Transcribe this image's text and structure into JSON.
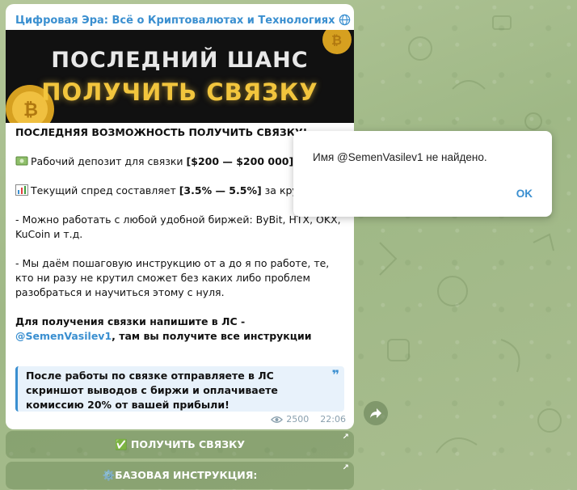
{
  "channel": {
    "title": "Цифровая Эра: Всё о Криптовалютах и Технологиях"
  },
  "banner": {
    "line1": "ПОСЛЕДНИЙ ШАНС",
    "line2": "ПОЛУЧИТЬ СВЯЗКУ"
  },
  "post": {
    "heading": "ПОСЛЕДНЯЯ ВОЗМОЖНОСТЬ ПОЛУЧИТЬ СВЯЗКУ!",
    "deposit_label": "Рабочий депозит для связки ",
    "deposit_value": "[$200 — $200 000]",
    "spread_label": "Текущий спред составляет ",
    "spread_value": "[3.5% — 5.5%]",
    "spread_suffix": " за круг",
    "exchanges": "- Можно работать с любой удобной биржей: ByBit, HTX, OKX, KuCoin и т.д.",
    "instruction": "- Мы даём пошаговую инструкцию от а до я по работе, те, кто ни разу не крутил сможет без каких либо проблем разобраться и научиться этому с нуля.",
    "contact_prefix": "Для получения связки напишите в ЛС - ",
    "contact_link": "@SemenVasilev1",
    "contact_suffix": ", там вы получите все инструкции",
    "quote": "После работы по связке отправляете в ЛС скриншот выводов с биржи и оплачиваете комиссию 20% от вашей прибыли!",
    "views": "2500",
    "time": "22:06"
  },
  "buttons": {
    "get_bundle": "✅ ПОЛУЧИТЬ СВЯЗКУ",
    "basic_instruction": "⚙️БАЗОВАЯ ИНСТРУКЦИЯ:"
  },
  "dialog": {
    "message": "Имя @SemenVasilev1 не найдено.",
    "ok_label": "OK"
  },
  "colors": {
    "accent": "#3a8fd0",
    "banner_yellow": "#f2c53d"
  }
}
